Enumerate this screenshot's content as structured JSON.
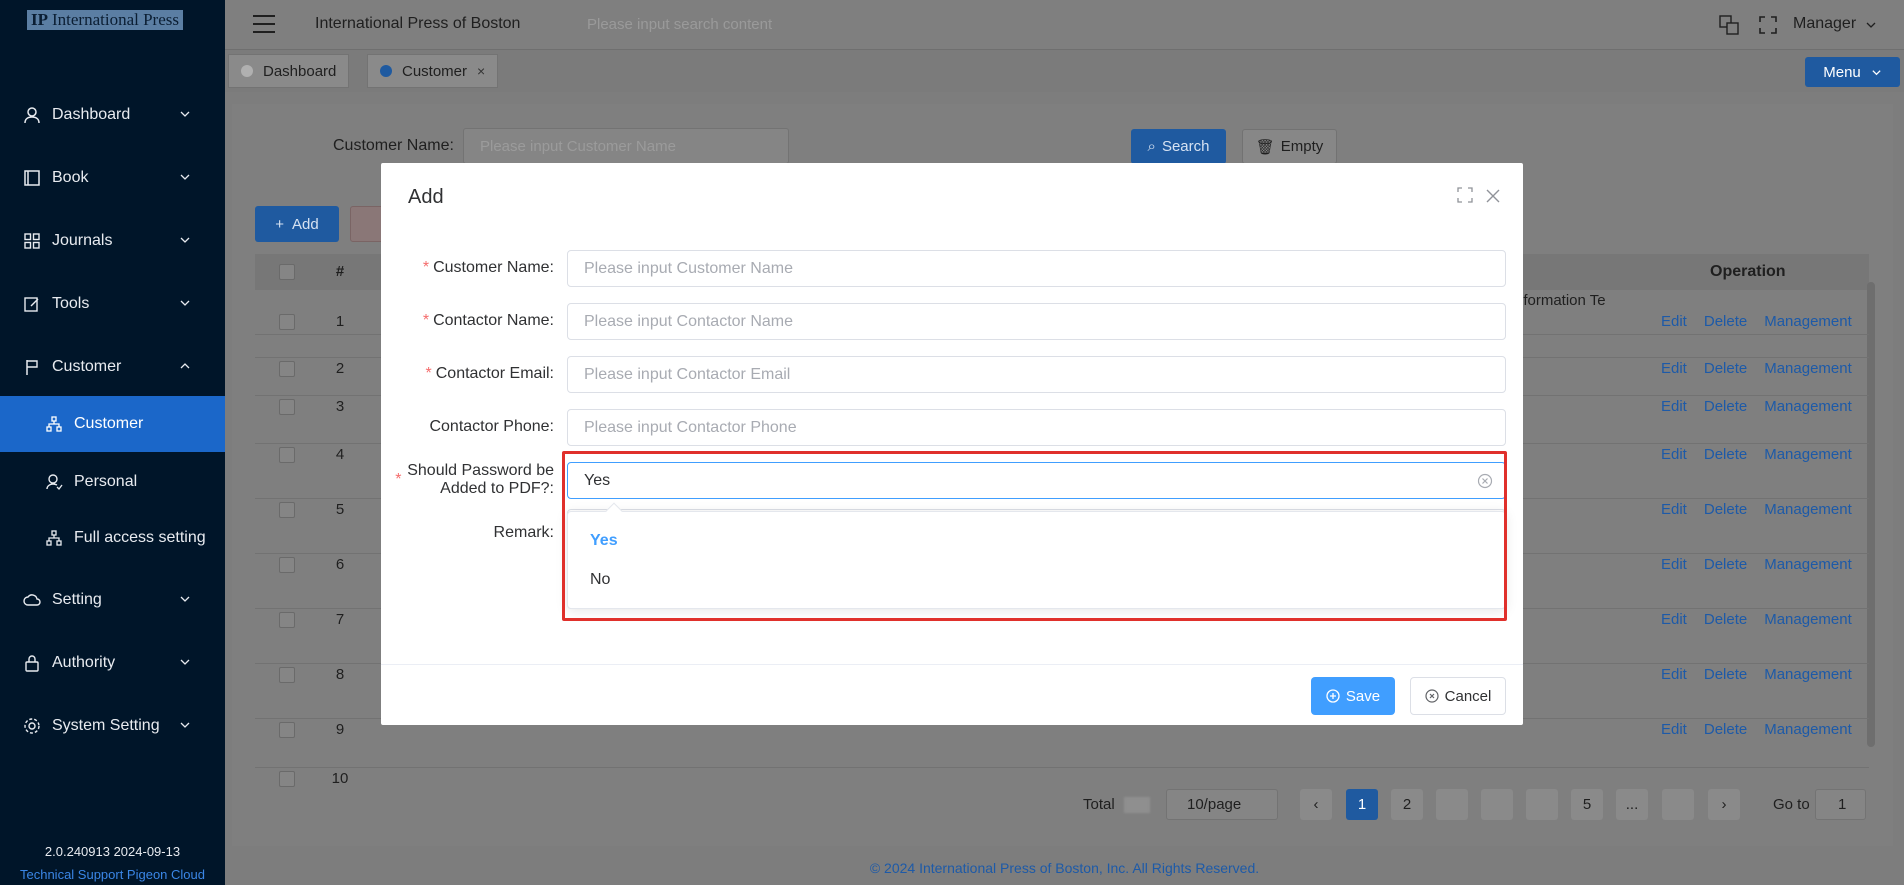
{
  "sidebar": {
    "logo_text": "International Press",
    "items": [
      {
        "label": "Dashboard",
        "icon": "user-icon"
      },
      {
        "label": "Book",
        "icon": "book-icon"
      },
      {
        "label": "Journals",
        "icon": "grid-icon"
      },
      {
        "label": "Tools",
        "icon": "edit-icon"
      },
      {
        "label": "Customer",
        "icon": "flag-icon"
      }
    ],
    "sub_items": [
      {
        "label": "Customer",
        "icon": "org-icon"
      },
      {
        "label": "Personal",
        "icon": "person-icon"
      },
      {
        "label": "Full access setting",
        "icon": "org-icon"
      }
    ],
    "bottom_items": [
      {
        "label": "Setting",
        "icon": "cloud-gear-icon"
      },
      {
        "label": "Authority",
        "icon": "lock-icon"
      },
      {
        "label": "System Setting",
        "icon": "gear-icon"
      }
    ],
    "version": "2.0.240913 2024-09-13",
    "support": "Technical Support Pigeon Cloud"
  },
  "header": {
    "site_title": "International Press of Boston",
    "search_placeholder": "Please input search content",
    "user": "Manager"
  },
  "tabs": [
    {
      "label": "Dashboard",
      "dot_color": "#b8b8b8"
    },
    {
      "label": "Customer",
      "dot_color": "#1f5aa0",
      "close": "×"
    }
  ],
  "menu_button": "Menu",
  "filter": {
    "label": "Customer Name:",
    "placeholder": "Please input Customer Name",
    "search": "Search",
    "empty": "Empty",
    "add": "Add"
  },
  "table": {
    "headers": {
      "index": "#",
      "operation": "Operation"
    },
    "partial_text": "nformation Te",
    "rows": [
      "1",
      "2",
      "3",
      "4",
      "5",
      "6",
      "7",
      "8",
      "9",
      "10"
    ],
    "ops": {
      "edit": "Edit",
      "delete": "Delete",
      "management": "Management"
    }
  },
  "pagination": {
    "total_label": "Total",
    "page_size": "10/page",
    "pages": [
      "1",
      "2",
      "5",
      "..."
    ],
    "go_to": "Go to",
    "go_value": "1"
  },
  "footer": "© 2024 International Press of Boston, Inc. All Rights Reserved.",
  "modal": {
    "title": "Add",
    "fields": {
      "customer_name": {
        "label": "Customer Name:",
        "placeholder": "Please input Customer Name"
      },
      "contactor_name": {
        "label": "Contactor Name:",
        "placeholder": "Please input Contactor Name"
      },
      "contactor_email": {
        "label": "Contactor Email:",
        "placeholder": "Please input Contactor Email"
      },
      "contactor_phone": {
        "label": "Contactor Phone:",
        "placeholder": "Please input Contactor Phone"
      },
      "password_pdf": {
        "label_line1": "Should Password be",
        "label_line2": "Added to PDF?:",
        "value": "Yes"
      },
      "remark": {
        "label": "Remark:"
      }
    },
    "options": [
      "Yes",
      "No"
    ],
    "required_mark": "*",
    "save": "Save",
    "cancel": "Cancel"
  },
  "colors": {
    "sidebar_bg": "#001529",
    "active_item": "#1b67c9",
    "primary": "#409eff",
    "highlight": "#e0302b"
  }
}
